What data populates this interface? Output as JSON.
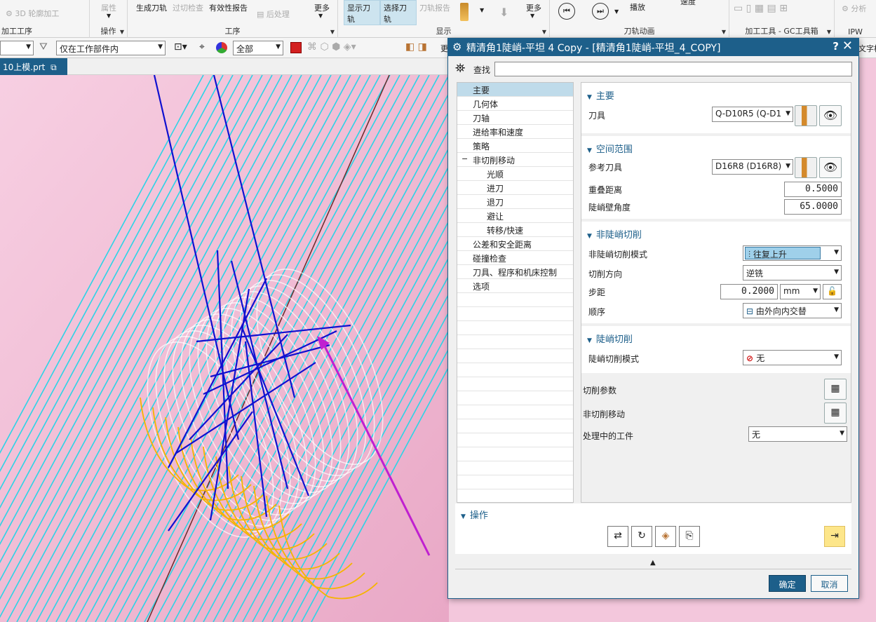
{
  "ribbon": {
    "items": [
      {
        "label": "3D 轮廓加工"
      },
      {
        "label": "属性"
      },
      {
        "label": "生成刀轨"
      },
      {
        "label": "过切检查"
      },
      {
        "label": "有效性报告"
      },
      {
        "label": "后处理"
      },
      {
        "label": "更多"
      },
      {
        "label": "显示刀轨"
      },
      {
        "label": "选择刀轨"
      },
      {
        "label": "刀轨报告"
      },
      {
        "label": "更多"
      },
      {
        "label": "播放"
      },
      {
        "label": "速度"
      },
      {
        "label": "分析"
      }
    ],
    "groups": [
      {
        "label": "加工工序"
      },
      {
        "label": "操作"
      },
      {
        "label": "工序"
      },
      {
        "label": "显示"
      },
      {
        "label": "刀轨动画"
      },
      {
        "label": "加工工具 - GC工具箱"
      },
      {
        "label": "IPW"
      }
    ]
  },
  "toolbar2": {
    "scope_filter": "仅在工作部件内",
    "type_filter": "全部",
    "more_label": "更",
    "extra_label": "文字格"
  },
  "tab": {
    "label": "10上模.prt"
  },
  "dialog": {
    "title": "精清角1陡峭-平坦 4 Copy - [精清角1陡峭-平坦_4_COPY]",
    "help": "?",
    "close": "✕",
    "find_label": "查找",
    "tree": [
      {
        "label": "主要",
        "indent": 0,
        "selected": true
      },
      {
        "label": "几何体",
        "indent": 0
      },
      {
        "label": "刀轴",
        "indent": 0
      },
      {
        "label": "进给率和速度",
        "indent": 0
      },
      {
        "label": "策略",
        "indent": 0
      },
      {
        "label": "非切削移动",
        "indent": 0,
        "expander": "−"
      },
      {
        "label": "光顺",
        "indent": 1
      },
      {
        "label": "进刀",
        "indent": 1
      },
      {
        "label": "退刀",
        "indent": 1
      },
      {
        "label": "避让",
        "indent": 1
      },
      {
        "label": "转移/快速",
        "indent": 1
      },
      {
        "label": "公差和安全距离",
        "indent": 0
      },
      {
        "label": "碰撞检查",
        "indent": 0
      },
      {
        "label": "刀具、程序和机床控制",
        "indent": 0
      },
      {
        "label": "选项",
        "indent": 0
      }
    ],
    "main": {
      "title": "主要",
      "tool_label": "刀具",
      "tool_value": "Q-D10R5 (Q-D1"
    },
    "space": {
      "title": "空间范围",
      "ref_tool_label": "参考刀具",
      "ref_tool_value": "D16R8 (D16R8)",
      "overlap_label": "重叠距离",
      "overlap_value": "0.5000",
      "steep_angle_label": "陡峭壁角度",
      "steep_angle_value": "65.0000"
    },
    "nonsteep": {
      "title": "非陡峭切削",
      "mode_label": "非陡峭切削模式",
      "mode_value": "往复上升",
      "dir_label": "切削方向",
      "dir_value": "逆铣",
      "step_label": "步距",
      "step_value": "0.2000",
      "step_unit": "mm",
      "order_label": "顺序",
      "order_value": "由外向内交替"
    },
    "steep": {
      "title": "陡峭切削",
      "mode_label": "陡峭切削模式",
      "mode_value": "无"
    },
    "cut_params_label": "切削参数",
    "noncut_label": "非切削移动",
    "ipw_label": "处理中的工件",
    "ipw_value": "无",
    "ops_title": "操作",
    "ok": "确定",
    "cancel": "取消"
  }
}
